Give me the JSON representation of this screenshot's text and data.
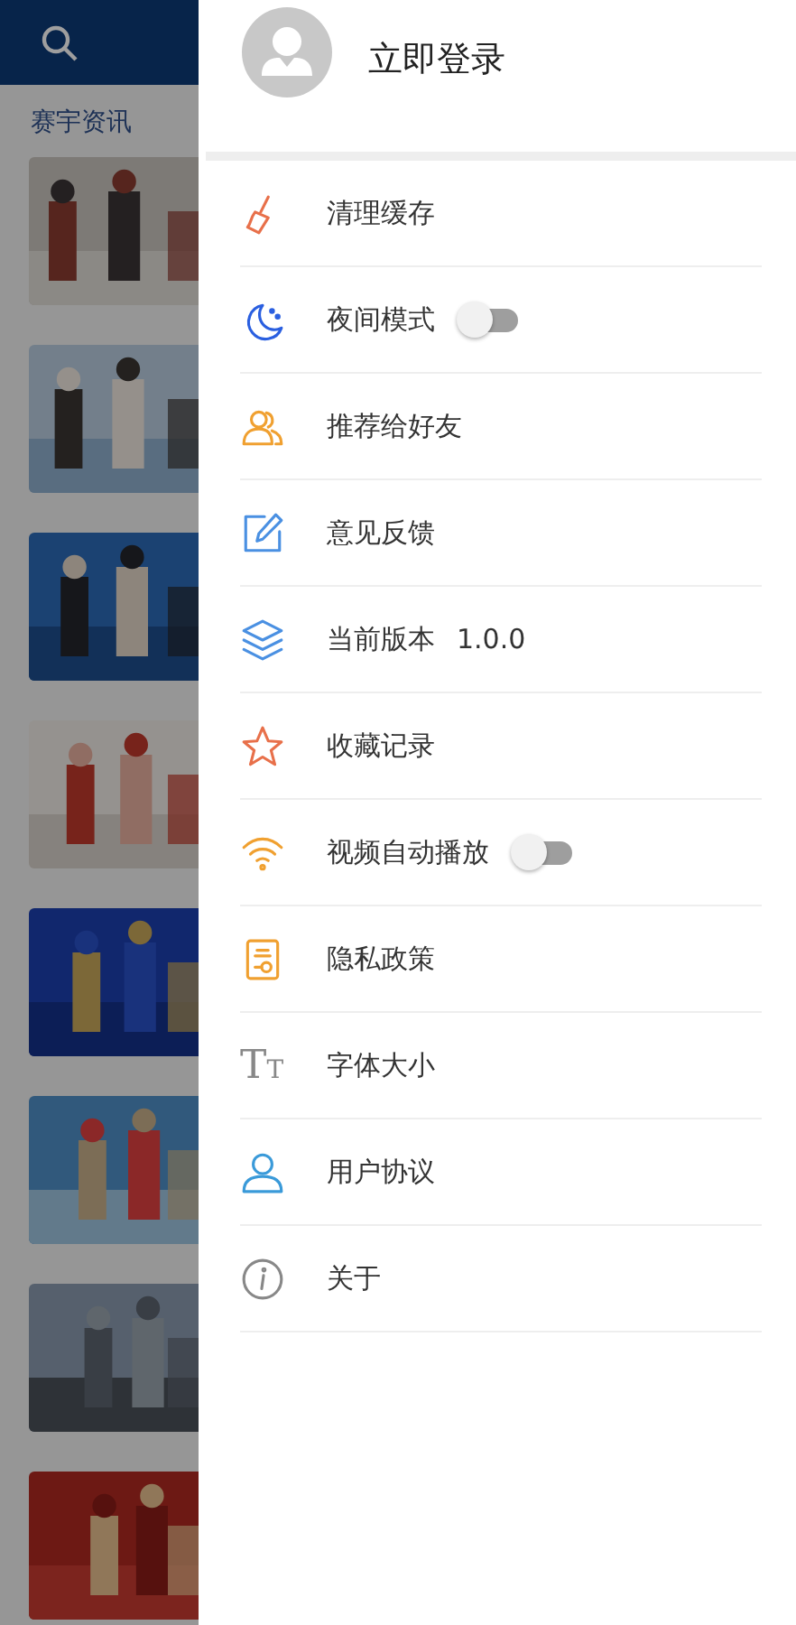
{
  "background": {
    "section_title": "赛宇资讯"
  },
  "drawer": {
    "login": "立即登录",
    "items": [
      {
        "label": "清理缓存"
      },
      {
        "label": "夜间模式",
        "kind": "toggle",
        "on": false
      },
      {
        "label": "推荐给好友"
      },
      {
        "label": "意见反馈"
      },
      {
        "label": "当前版本",
        "kind": "value",
        "value": "1.0.0"
      },
      {
        "label": "收藏记录"
      },
      {
        "label": "视频自动播放",
        "kind": "toggle",
        "on": false
      },
      {
        "label": "隐私政策"
      },
      {
        "label": "字体大小",
        "icon_text": "TT"
      },
      {
        "label": "用户协议"
      },
      {
        "label": "关于"
      }
    ]
  }
}
